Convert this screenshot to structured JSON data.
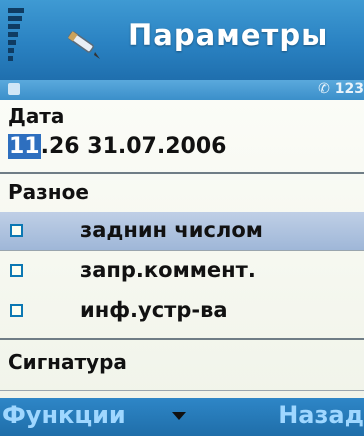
{
  "header": {
    "title": "Параметры",
    "app_icon": "pencil-icon",
    "status_right": "123"
  },
  "fields": {
    "date_label": "Дата",
    "datetime_highlight": "11",
    "datetime_rest": ".26 31.07.2006",
    "misc_label": "Разное",
    "signature_label": "Сигнатура"
  },
  "options": [
    {
      "label": "заднин числом",
      "selected": true
    },
    {
      "label": "запр.коммент.",
      "selected": false
    },
    {
      "label": "инф.устр-ва",
      "selected": false
    }
  ],
  "softkeys": {
    "left": "Функции",
    "right": "Назад"
  },
  "colors": {
    "title_bar": "#2a82c2",
    "highlight": "#9fb7d8",
    "checkbox_border": "#0c78b3",
    "softkey_text": "#9fd7ff"
  }
}
